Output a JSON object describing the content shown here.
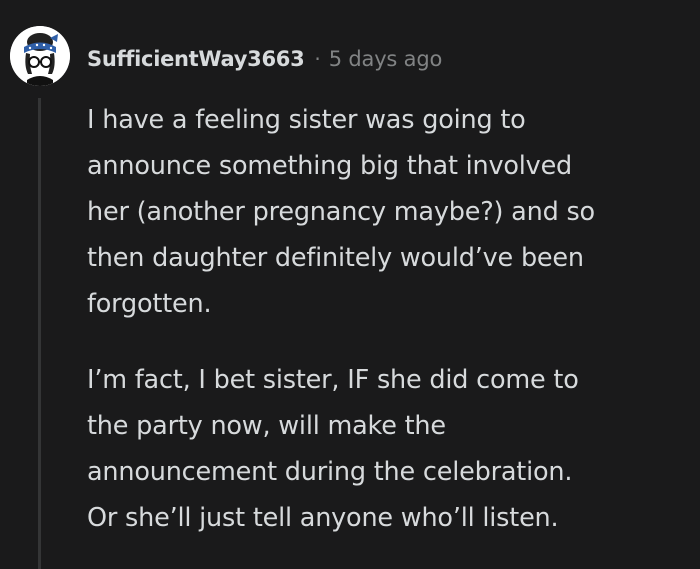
{
  "comment": {
    "username": "SufficientWay3663",
    "separator": "·",
    "timestamp": "5 days ago",
    "avatar_icon": "avatar-icon",
    "paragraphs": [
      {
        "lines": [
          "I have a feeling sister was going to",
          "announce something big that involved",
          "her (another pregnancy maybe?) and so",
          "then daughter definitely would’ve been",
          "forgotten."
        ]
      },
      {
        "lines": [
          "I’m fact, I bet sister, IF she did come to",
          "the party now, will make the",
          "announcement during the celebration.",
          "Or she’ll just tell anyone who’ll listen."
        ]
      }
    ]
  },
  "colors": {
    "background": "#1a1a1b",
    "text": "#d7dadc",
    "meta": "#818384",
    "thread_line": "#343536"
  }
}
